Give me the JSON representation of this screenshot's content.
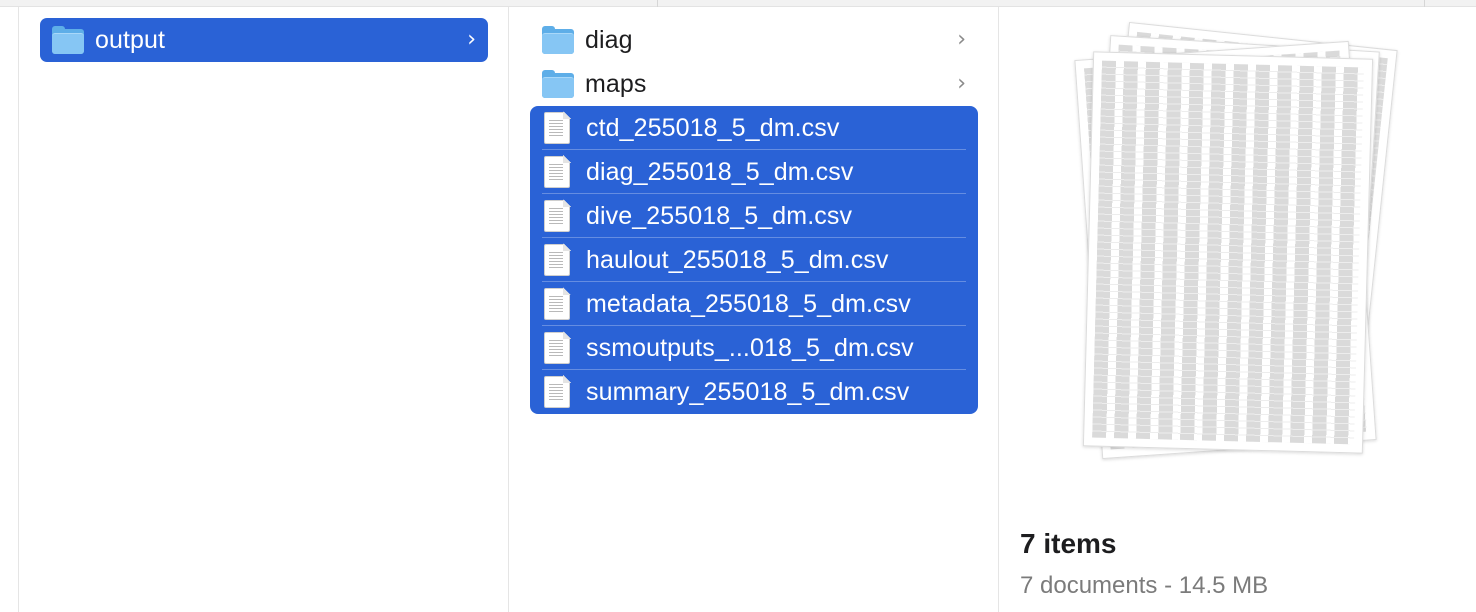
{
  "column1": {
    "items": [
      {
        "name": "output",
        "kind": "folder",
        "selected": true
      }
    ]
  },
  "column2": {
    "folders": [
      {
        "name": "diag"
      },
      {
        "name": "maps"
      }
    ],
    "files": [
      {
        "name": "ctd_255018_5_dm.csv"
      },
      {
        "name": "diag_255018_5_dm.csv"
      },
      {
        "name": "dive_255018_5_dm.csv"
      },
      {
        "name": "haulout_255018_5_dm.csv"
      },
      {
        "name": "metadata_255018_5_dm.csv"
      },
      {
        "name": "ssmoutputs_...018_5_dm.csv"
      },
      {
        "name": "summary_255018_5_dm.csv"
      }
    ]
  },
  "preview": {
    "title": "7 items",
    "subtitle": "7 documents - 14.5 MB"
  },
  "colors": {
    "selection": "#2a62d6",
    "folder": "#86c6f4"
  },
  "icons": {
    "folder": "folder-icon",
    "document": "csv-document-icon",
    "chevron": "chevron-right-icon"
  }
}
